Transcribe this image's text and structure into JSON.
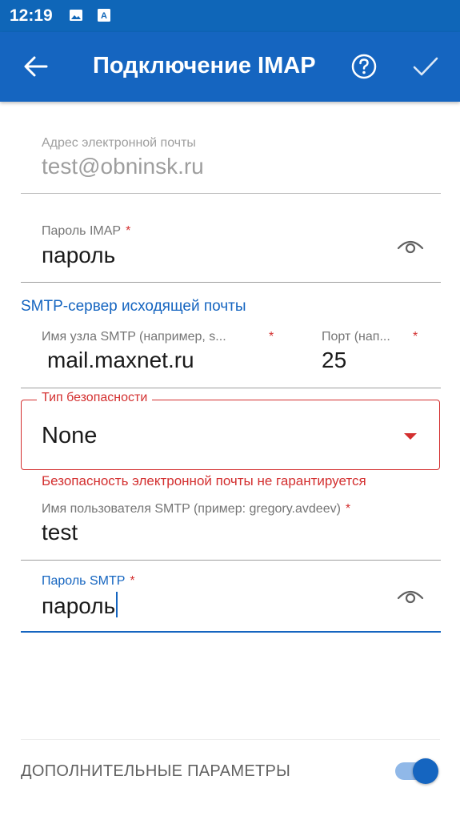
{
  "status_bar": {
    "time": "12:19",
    "icons": [
      "image-icon",
      "text-box-icon"
    ]
  },
  "app_bar": {
    "title": "Подключение IMAP",
    "back_icon": "arrow-left-icon",
    "help_icon": "help-circle-icon",
    "confirm_icon": "check-icon",
    "color": "#1565c0"
  },
  "form": {
    "email": {
      "label": "Адрес электронной почты",
      "value": "test@obninsk.ru"
    },
    "imap_password": {
      "label": "Пароль IMAP",
      "required_mark": "*",
      "value": "пароль",
      "visibility_icon": "eye-icon"
    },
    "smtp_section_title": "SMTP-сервер исходящей почты",
    "smtp_host": {
      "label": "Имя узла SMTP (например, s...",
      "required_mark": "*",
      "value": "mail.maxnet.ru"
    },
    "smtp_port": {
      "label": "Порт (нап...",
      "required_mark": "*",
      "value": "25"
    },
    "security_type": {
      "label": "Тип безопасности",
      "value": "None",
      "error": "Безопасность электронной почты не гарантируется",
      "error_color": "#d32f2f"
    },
    "smtp_user": {
      "label": "Имя пользователя SMTP (пример: gregory.avdeev)",
      "required_mark": "*",
      "value": "test"
    },
    "smtp_password": {
      "label": "Пароль SMTP",
      "required_mark": "*",
      "value": "пароль",
      "visibility_icon": "eye-icon"
    }
  },
  "advanced": {
    "label": "ДОПОЛНИТЕЛЬНЫЕ ПАРАМЕТРЫ",
    "enabled": true
  }
}
